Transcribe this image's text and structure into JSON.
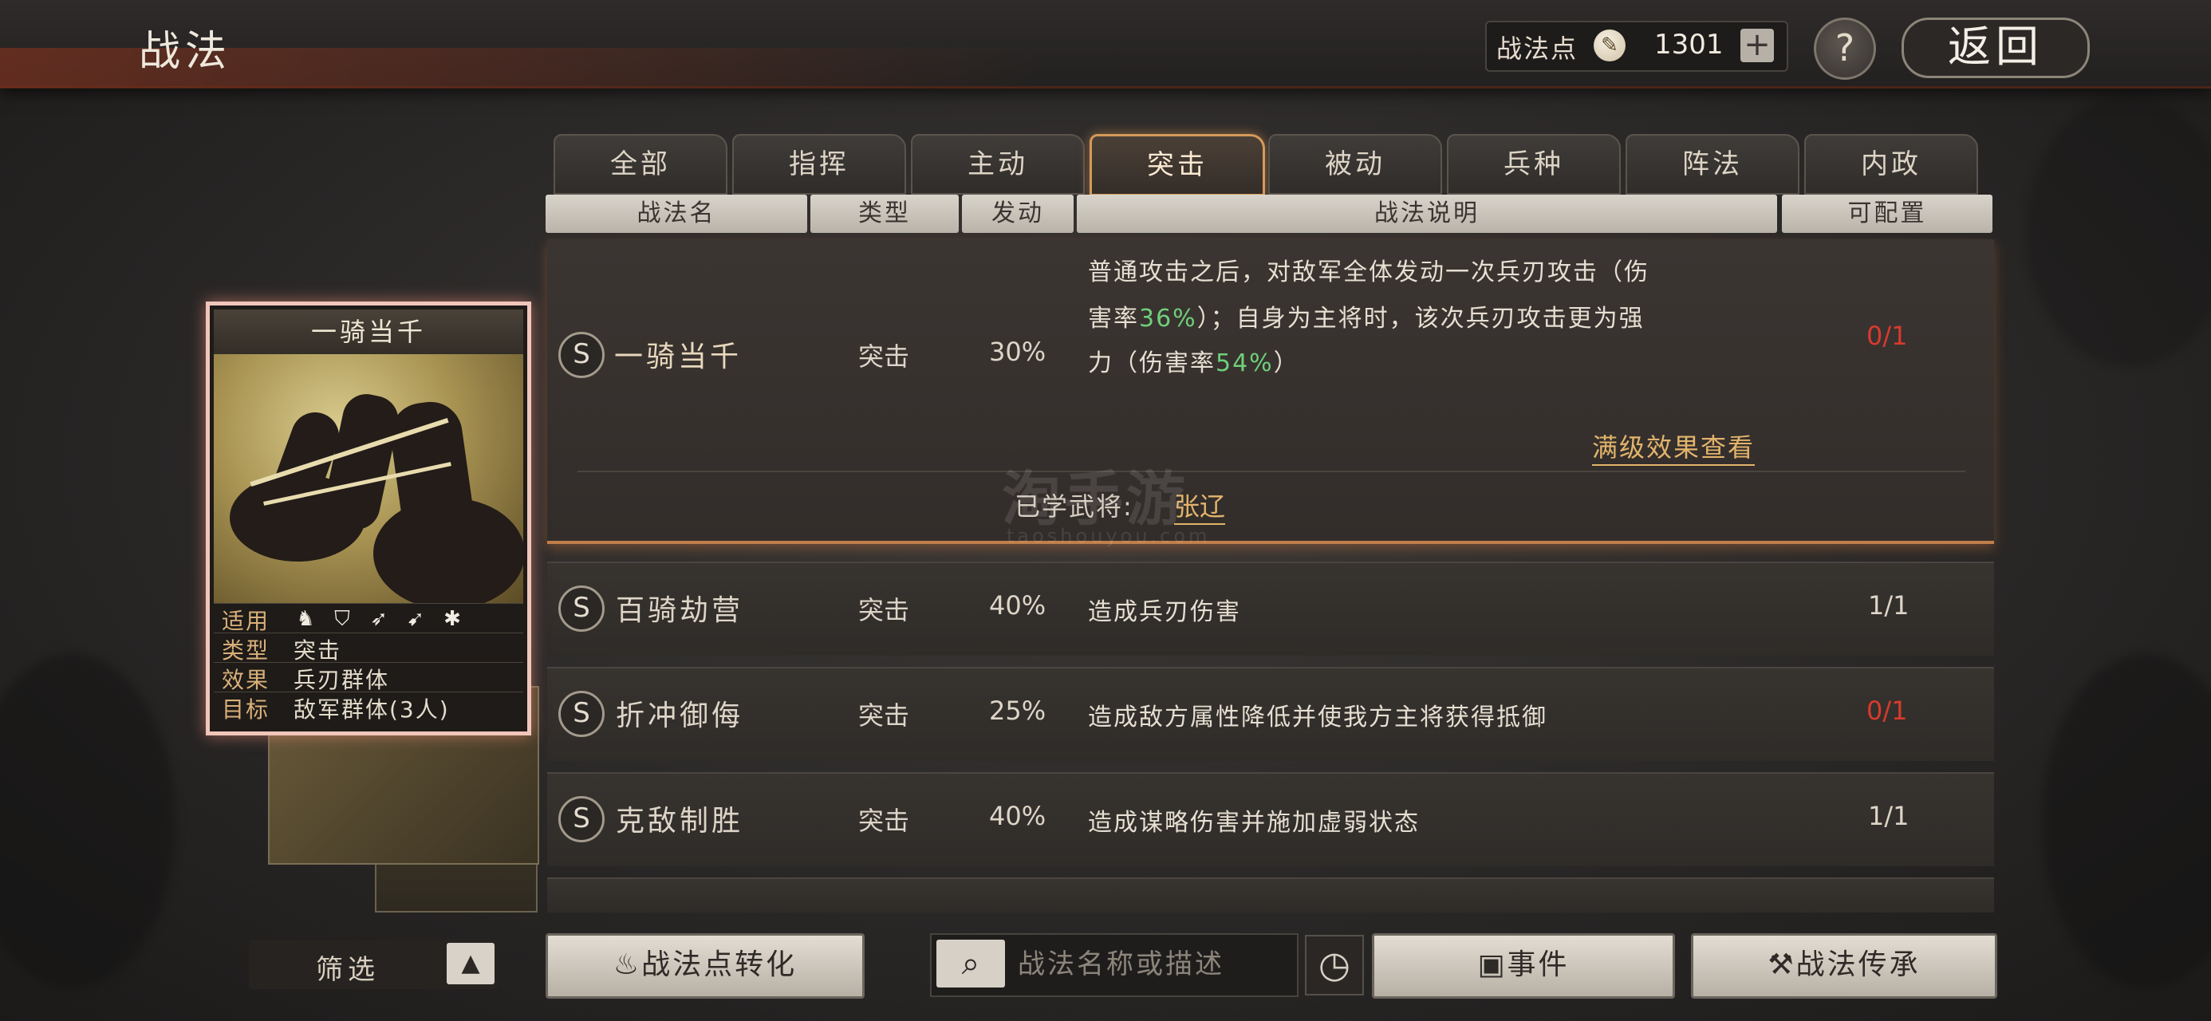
{
  "header": {
    "title": "战法",
    "points_label": "战法点",
    "points_value": "1301",
    "add_symbol": "+",
    "help_symbol": "?",
    "back_label": "返回"
  },
  "tabs": [
    {
      "label": "全部",
      "active": false
    },
    {
      "label": "指挥",
      "active": false
    },
    {
      "label": "主动",
      "active": false
    },
    {
      "label": "突击",
      "active": true
    },
    {
      "label": "被动",
      "active": false
    },
    {
      "label": "兵种",
      "active": false
    },
    {
      "label": "阵法",
      "active": false
    },
    {
      "label": "内政",
      "active": false
    }
  ],
  "columns": {
    "name": "战法名",
    "type": "类型",
    "trigger": "发动",
    "desc": "战法说明",
    "config": "可配置"
  },
  "rows": [
    {
      "grade": "S",
      "name": "一骑当千",
      "type": "突击",
      "rate": "30%",
      "desc_lines": [
        [
          "普通攻击之后，对敌军全体发动一次兵刃攻击（伤"
        ],
        [
          "害率",
          "36%",
          "）；自身为主将时，该次兵刃攻击更为强"
        ],
        [
          "力（伤害率",
          "54%",
          "）"
        ]
      ],
      "config": "0/1",
      "config_full": false,
      "detail_link": "满级效果查看",
      "learned_label": "已学武将:",
      "learned_general": "张辽"
    },
    {
      "grade": "S",
      "name": "百骑劫营",
      "type": "突击",
      "rate": "40%",
      "desc": "造成兵刃伤害",
      "config": "1/1",
      "config_full": true
    },
    {
      "grade": "S",
      "name": "折冲御侮",
      "type": "突击",
      "rate": "25%",
      "desc": "造成敌方属性降低并使我方主将获得抵御",
      "config": "0/1",
      "config_full": false
    },
    {
      "grade": "S",
      "name": "克敌制胜",
      "type": "突击",
      "rate": "40%",
      "desc": "造成谋略伤害并施加虚弱状态",
      "config": "1/1",
      "config_full": true
    }
  ],
  "card": {
    "title": "一骑当千",
    "apply_label": "适用",
    "apply_icons": [
      "cavalry-icon",
      "shield-icon",
      "bow-icon",
      "spear-icon",
      "siege-icon"
    ],
    "type_label": "类型",
    "type_value": "突击",
    "effect_label": "效果",
    "effect_value": "兵刃群体",
    "target_label": "目标",
    "target_value": "敌军群体(3人)"
  },
  "watermark": {
    "text": "淘手游",
    "url": "taoshouyou.com"
  },
  "bottom": {
    "filter_label": "筛选",
    "convert_label": "战法点转化",
    "search_placeholder": "战法名称或描述",
    "event_label": "事件",
    "inherit_label": "战法传承"
  },
  "colors": {
    "accent": "#d49a5a",
    "link": "#e3b46c",
    "red": "#d83a2e",
    "green": "#6fcf7a"
  }
}
